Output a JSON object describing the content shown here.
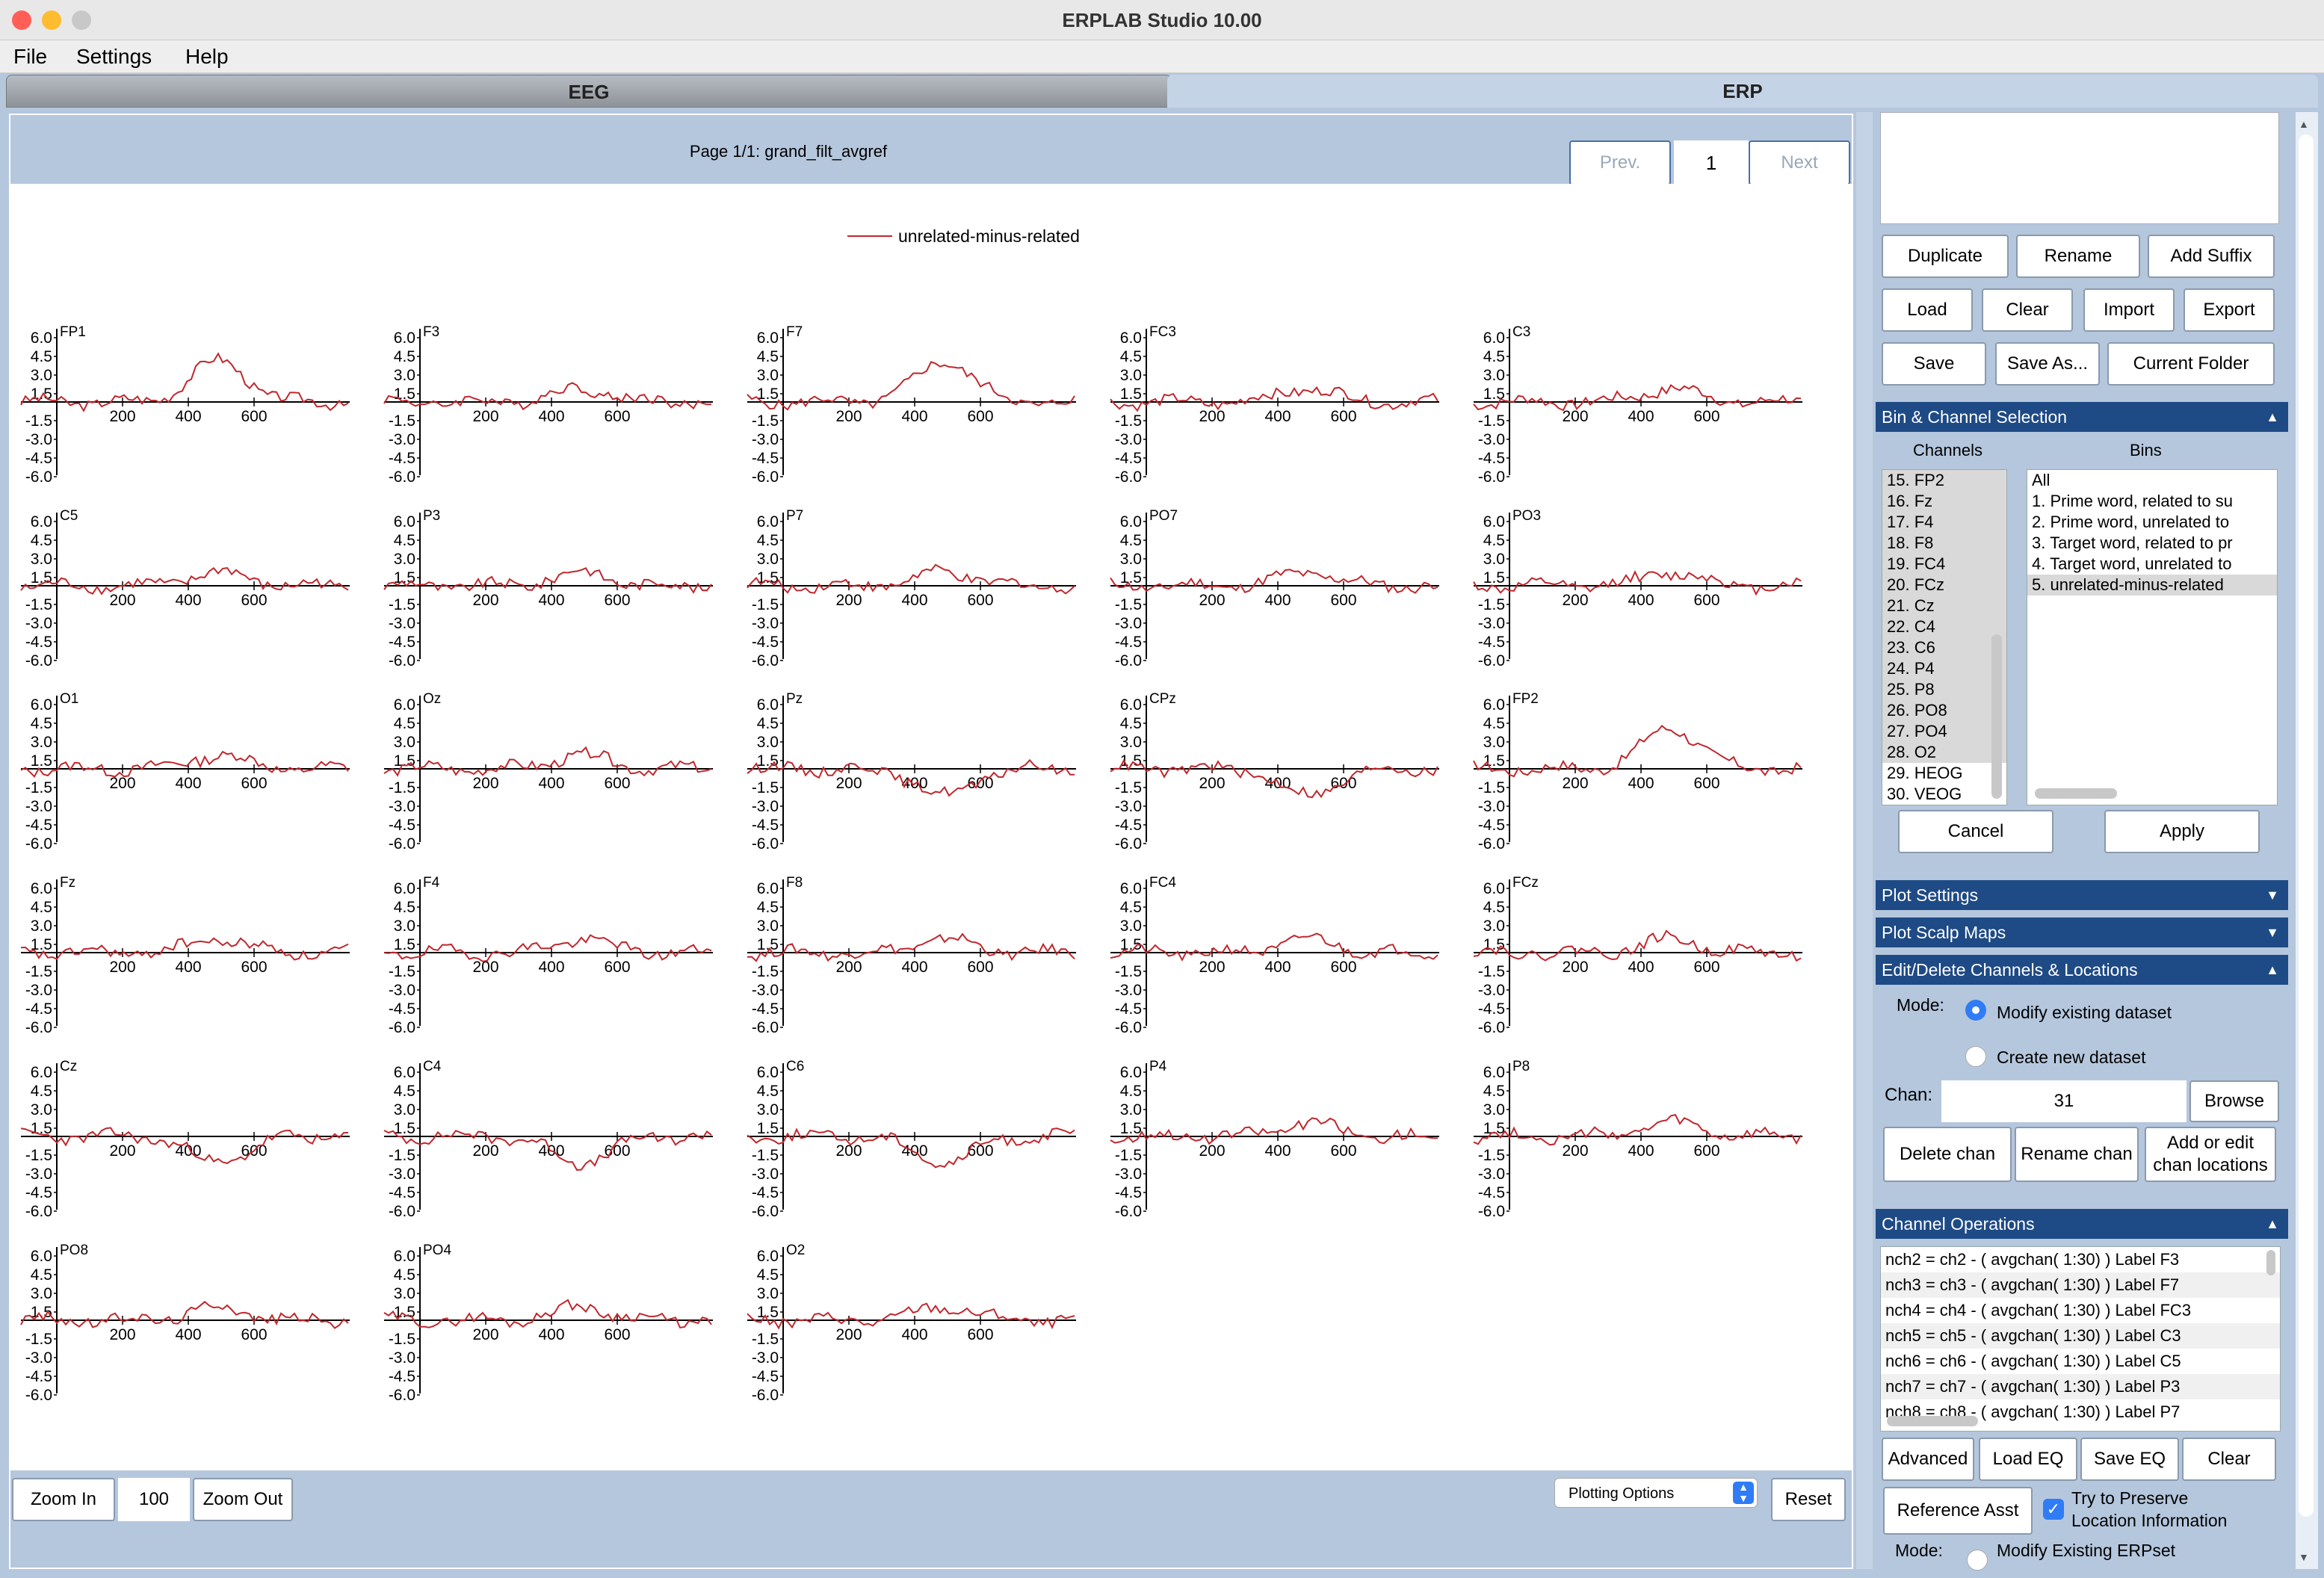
{
  "window": {
    "title": "ERPLAB Studio 10.00"
  },
  "menu": [
    "File",
    "Settings",
    "Help"
  ],
  "tabs": {
    "eeg": "EEG",
    "erp": "ERP"
  },
  "page": {
    "title": "Page 1/1: grand_filt_avgref",
    "prev": "Prev.",
    "page_number": "1",
    "next": "Next"
  },
  "legend": {
    "series": "unrelated-minus-related",
    "color": "#c0272d"
  },
  "plot": {
    "yticks": [
      "6.0",
      "4.5",
      "3.0",
      "1.5",
      "-1.5",
      "-3.0",
      "-4.5",
      "-6.0"
    ],
    "xticks": [
      "200",
      "400",
      "600"
    ],
    "channels": [
      "FP1",
      "F3",
      "F7",
      "FC3",
      "C3",
      "C5",
      "P3",
      "P7",
      "PO7",
      "PO3",
      "O1",
      "Oz",
      "Pz",
      "CPz",
      "FP2",
      "Fz",
      "F4",
      "F8",
      "FC4",
      "FCz",
      "Cz",
      "C4",
      "C6",
      "P4",
      "P8",
      "PO8",
      "PO4",
      "O2"
    ]
  },
  "bottom": {
    "zoom_in": "Zoom In",
    "zoom_value": "100",
    "zoom_out": "Zoom Out",
    "plotting_options": "Plotting Options",
    "reset": "Reset"
  },
  "right": {
    "erpset_buttons": [
      "Duplicate",
      "Rename",
      "Add Suffix",
      "Load",
      "Clear",
      "Import",
      "Export",
      "Save",
      "Save As...",
      "Current Folder"
    ],
    "bin_channel": {
      "title": "Bin & Channel Selection",
      "channels_label": "Channels",
      "bins_label": "Bins",
      "channels": [
        "15. FP2",
        "16. Fz",
        "17. F4",
        "18. F8",
        "19. FC4",
        "20. FCz",
        "21. Cz",
        "22. C4",
        "23. C6",
        "24. P4",
        "25. P8",
        "26. PO8",
        "27. PO4",
        "28. O2",
        "29. HEOG",
        "30. VEOG"
      ],
      "bins": [
        "All",
        "1. Prime word, related to su",
        "2. Prime word, unrelated to",
        "3. Target word, related to pr",
        "4. Target word, unrelated to",
        "5. unrelated-minus-related"
      ],
      "cancel": "Cancel",
      "apply": "Apply"
    },
    "plot_settings": "Plot Settings",
    "plot_scalp_maps": "Plot Scalp Maps",
    "edit_channels": {
      "title": "Edit/Delete Channels & Locations",
      "mode_label": "Mode:",
      "modify": "Modify existing dataset",
      "create": "Create new dataset",
      "chan_label": "Chan:",
      "chan_value": "31",
      "browse": "Browse",
      "delete_chan": "Delete chan",
      "rename_chan": "Rename chan",
      "add_edit_1": "Add or edit",
      "add_edit_2": "chan locations"
    },
    "channel_ops": {
      "title": "Channel Operations",
      "equations": [
        "nch2 = ch2 - ( avgchan( 1:30) ) Label F3",
        "nch3 = ch3 - ( avgchan( 1:30) ) Label F7",
        "nch4 = ch4 - ( avgchan( 1:30) ) Label FC3",
        "nch5 = ch5 - ( avgchan( 1:30) ) Label C3",
        "nch6 = ch6 - ( avgchan( 1:30) ) Label C5",
        "nch7 = ch7 - ( avgchan( 1:30) ) Label P3",
        "nch8 = ch8 - ( avgchan( 1:30) ) Label P7"
      ],
      "advanced": "Advanced",
      "load_eq": "Load EQ",
      "save_eq": "Save EQ",
      "clear": "Clear",
      "reference_asst": "Reference Asst",
      "try_preserve_1": "Try to Preserve",
      "try_preserve_2": "Location Information",
      "mode_label": "Mode:",
      "modify_erpset": "Modify Existing ERPset"
    }
  }
}
